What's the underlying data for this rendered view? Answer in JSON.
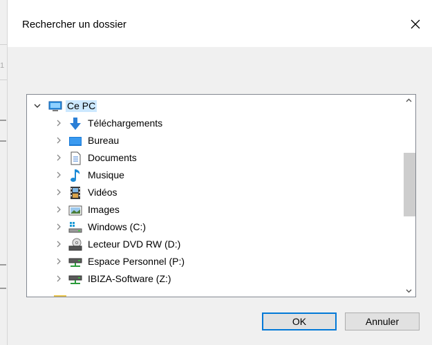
{
  "dialog": {
    "title": "Rechercher un dossier",
    "ok_label": "OK",
    "cancel_label": "Annuler"
  },
  "background": {
    "side_number": "1"
  },
  "tree": {
    "root": {
      "label": "Ce PC",
      "icon": "computer-icon",
      "expanded": true,
      "selected": true
    },
    "items": [
      {
        "label": "Téléchargements",
        "icon": "download-arrow-icon"
      },
      {
        "label": "Bureau",
        "icon": "desktop-icon"
      },
      {
        "label": "Documents",
        "icon": "document-icon"
      },
      {
        "label": "Musique",
        "icon": "music-note-icon"
      },
      {
        "label": "Vidéos",
        "icon": "film-icon"
      },
      {
        "label": "Images",
        "icon": "picture-icon"
      },
      {
        "label": "Windows (C:)",
        "icon": "windows-drive-icon"
      },
      {
        "label": "Lecteur DVD RW (D:)",
        "icon": "dvd-drive-icon"
      },
      {
        "label": "Espace Personnel (P:)",
        "icon": "network-drive-icon"
      },
      {
        "label": "IBIZA-Software (Z:)",
        "icon": "network-drive-icon"
      }
    ]
  },
  "colors": {
    "selection": "#cce8ff",
    "focus_border": "#0078d7",
    "dialog_bg": "#f0f0f0"
  }
}
